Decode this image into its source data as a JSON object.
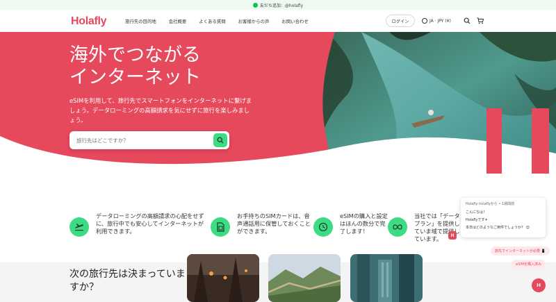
{
  "topbar": {
    "text": "友だち追加：@holafly"
  },
  "header": {
    "logo": "Holafly",
    "nav": [
      "旅行先の目的地",
      "会社概要",
      "よくある質問",
      "お客様からの声",
      "お問い合わせ"
    ],
    "login": "ログイン",
    "lang": "JA · JPY (¥)"
  },
  "hero": {
    "title_line1": "海外でつながる",
    "title_line2": "インターネット",
    "subtitle": "eSIMを利用して、旅行先でスマートフォンをインターネットに繋げましょう。データローミングの高額請求を気にせずに旅行を楽しみましょう。",
    "search_placeholder": "旅行先はどこですか？"
  },
  "features": [
    {
      "icon": "airplane-icon",
      "text": "データローミングの高額請求の心配をせずに、旅行中でも安心してインターネットが利用できます。"
    },
    {
      "icon": "sim-card-icon",
      "text": "お手持ちのSIMカードは、音声通話用に保管しておくことができます。"
    },
    {
      "icon": "clock-icon",
      "text": "eSIMの購入と設定はほんの数分で完了します！"
    },
    {
      "icon": "infinity-icon",
      "text": "当社では「データプラン」を提供していま域で提供しています。"
    }
  ],
  "bottom": {
    "title": "次の旅行先は決まっていますか？"
  },
  "chat": {
    "header": "Holafly holaflyから • 1週間前",
    "greeting": "こんにちは！",
    "name": "Holaflyです✈",
    "question": "本日はどのようなご用件でしょうか？ 😊",
    "chip1": "旅先でインターネットが必要 📱",
    "chip2": "eSIMを購入済み"
  },
  "colors": {
    "brand": "#e6485c",
    "accent": "#3ddc84"
  }
}
